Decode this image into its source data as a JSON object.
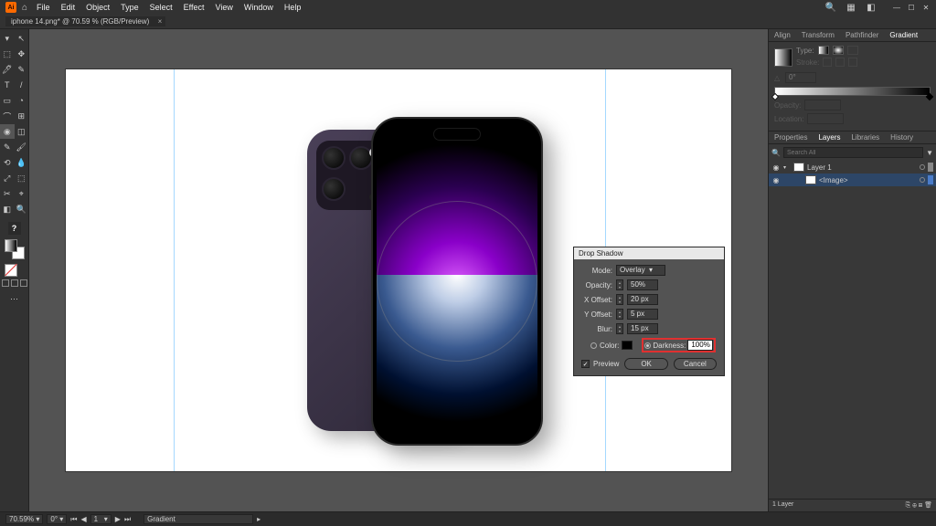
{
  "app": {
    "badge": "Ai"
  },
  "menus": [
    "File",
    "Edit",
    "Object",
    "Type",
    "Select",
    "Effect",
    "View",
    "Window",
    "Help"
  ],
  "doc_tab": {
    "title": "iphone 14.png* @ 70.59 % (RGB/Preview)"
  },
  "dialog": {
    "title": "Drop Shadow",
    "mode_label": "Mode:",
    "mode_value": "Overlay",
    "opacity_label": "Opacity:",
    "opacity_value": "50%",
    "xoff_label": "X Offset:",
    "xoff_value": "20 px",
    "yoff_label": "Y Offset:",
    "yoff_value": "5 px",
    "blur_label": "Blur:",
    "blur_value": "15 px",
    "color_label": "Color:",
    "darkness_label": "Darkness:",
    "darkness_value": "100%",
    "preview_label": "Preview",
    "ok": "OK",
    "cancel": "Cancel"
  },
  "panels_top": {
    "align": "Align",
    "transform": "Transform",
    "pathfinder": "Pathfinder",
    "gradient": "Gradient"
  },
  "gradient": {
    "type_label": "Type:",
    "stroke_label": "Stroke:",
    "angle_val": "0°",
    "opacity_label": "Opacity:",
    "location_label": "Location:"
  },
  "panels_mid": {
    "properties": "Properties",
    "layers": "Layers",
    "libraries": "Libraries",
    "history": "History"
  },
  "layers": {
    "search_placeholder": "Search All",
    "items": [
      {
        "name": "Layer 1"
      },
      {
        "name": "<Image>"
      }
    ],
    "footer_count": "1 Layer"
  },
  "status": {
    "zoom": "70.59%",
    "rotate": "0°",
    "artboard_nav": "1",
    "tool_hint": "Gradient"
  },
  "tool_glyphs": [
    [
      "▾",
      "↖"
    ],
    [
      "⬚",
      "✥"
    ],
    [
      "🖊",
      "✎"
    ],
    [
      "T",
      "/"
    ],
    [
      "▭",
      "◔"
    ],
    [
      "⌒",
      "⊞"
    ],
    [
      "◉",
      "◫"
    ],
    [
      "✎",
      "🖌"
    ],
    [
      "⟲",
      "💧"
    ],
    [
      "⤢",
      "⬚"
    ],
    [
      "✂",
      "⌖"
    ],
    [
      "◧",
      "🔍"
    ]
  ]
}
